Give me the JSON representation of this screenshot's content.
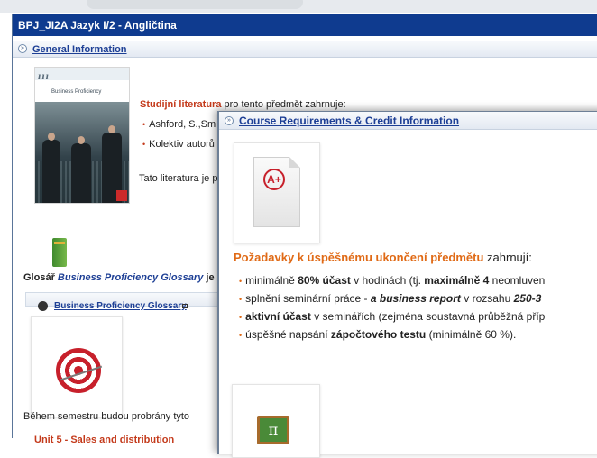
{
  "window": {
    "title": "BPJ_JI2A Jazyk I/2 - Angličtina"
  },
  "general": {
    "header": "General Information",
    "book_logo": "ııı",
    "book_title": "Business Proficiency",
    "lit_label": "Studijní literatura",
    "lit_rest": " pro tento předmět zahrnuje:",
    "lit_items": [
      "Ashford, S.,Sm",
      "Kolektiv autorů"
    ],
    "lit_note": "Tato literatura je pr",
    "glossary_prefix": "Glosář ",
    "glossary_name": "Business Proficiency Glossary",
    "glossary_suffix": " je",
    "glossary_link": "Business Proficiency Glossary",
    "semester_text": "Během semestru budou probrány tyto",
    "unit_cut": "Unit 5 - Sales and distribution"
  },
  "overlay": {
    "header": "Course Requirements & Credit Information",
    "grade_badge": "A+",
    "req_head_bold": "Požadavky k úspěšnému ukončení předmětu",
    "req_head_rest": " zahrnují:",
    "items": [
      {
        "a": "minimálně ",
        "b": "80% účast",
        "c": " v hodinách (tj. ",
        "d": "maximálně 4",
        "e": " neomluven"
      },
      {
        "a": "splnění seminární práce - ",
        "b": "a business report",
        "c": " v rozsahu ",
        "d": "250-3",
        "e": ""
      },
      {
        "a": "",
        "b": "aktivní účast",
        "c": " v seminářích (zejména soustavná průběžná příp",
        "d": "",
        "e": ""
      },
      {
        "a": "úspěšné napsání ",
        "b": "zápočtového testu",
        "c": " (minimálně 60 %).",
        "d": "",
        "e": ""
      }
    ],
    "pi_icon": "π"
  },
  "colors": {
    "title_bar": "#0f3b8f",
    "accent_orange": "#e06a16",
    "accent_red": "#c43a1b",
    "link_blue": "#1d3f95"
  }
}
